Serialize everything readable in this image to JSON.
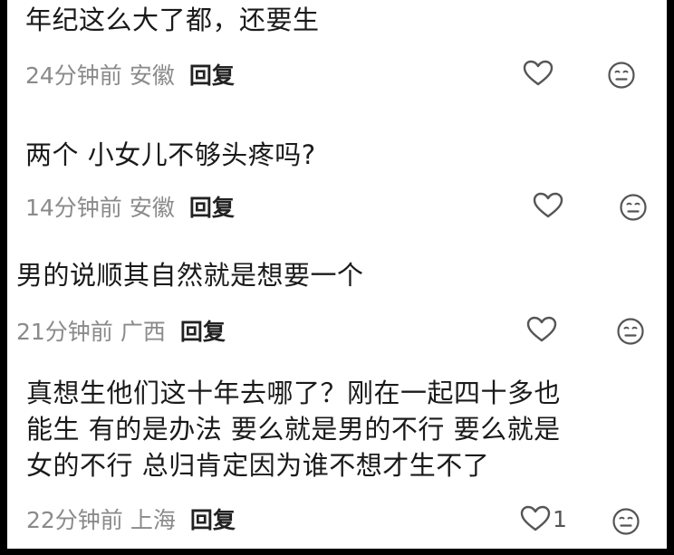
{
  "comments": [
    {
      "text_lines": [
        "年纪这么大了都，还要生"
      ],
      "time": "24分钟前",
      "location": "安徽",
      "reply_label": "回复",
      "like_count": ""
    },
    {
      "text_lines": [
        "两个 小女儿不够头疼吗?"
      ],
      "time": "14分钟前",
      "location": "安徽",
      "reply_label": "回复",
      "like_count": ""
    },
    {
      "text_lines": [
        "男的说顺其自然就是想要一个"
      ],
      "time": "21分钟前",
      "location": "广西",
      "reply_label": "回复",
      "like_count": ""
    },
    {
      "text_lines": [
        "真想生他们这十年去哪了？刚在一起四十多也",
        "能生 有的是办法 要么就是男的不行 要么就是",
        "女的不行 总归肯定因为谁不想才生不了"
      ],
      "time": "22分钟前",
      "location": "上海",
      "reply_label": "回复",
      "like_count": "1"
    }
  ],
  "icons": {
    "like": "heart-outline-icon",
    "reaction": "neutral-face-icon"
  },
  "colors": {
    "text": "#1a1a1a",
    "meta": "#8a8a8a",
    "icon": "#555555",
    "background": "#ffffff"
  }
}
